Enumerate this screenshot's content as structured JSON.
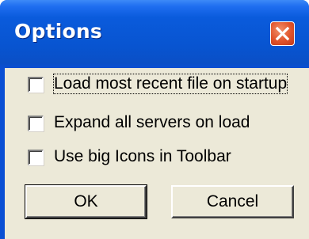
{
  "dialog": {
    "title": "Options",
    "close_icon": "close-icon",
    "checkboxes": [
      {
        "label": "Load most recent file on startup",
        "checked": false
      },
      {
        "label": "Expand all servers on load",
        "checked": false
      },
      {
        "label": "Use big Icons in Toolbar",
        "checked": false
      }
    ],
    "ok_label": "OK",
    "cancel_label": "Cancel"
  },
  "colors": {
    "titlebar": "#0a4fd4",
    "close_button": "#e0532a",
    "client_background": "#ece9d8"
  }
}
